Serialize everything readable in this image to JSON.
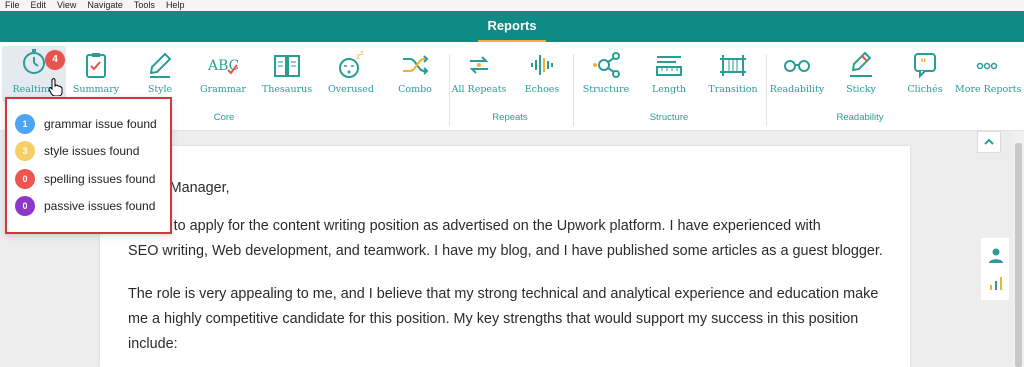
{
  "menu": [
    "File",
    "Edit",
    "View",
    "Navigate",
    "Tools",
    "Help"
  ],
  "header": {
    "title": "Reports"
  },
  "badge_count": "4",
  "tools": [
    {
      "label": "Realtime",
      "icon": "stopwatch-icon"
    },
    {
      "label": "Summary",
      "icon": "clipboard-icon"
    },
    {
      "label": "Style",
      "icon": "pen-icon"
    },
    {
      "label": "Grammar",
      "icon": "abc-check-icon"
    },
    {
      "label": "Thesaurus",
      "icon": "book-icon"
    },
    {
      "label": "Overused",
      "icon": "sleepy-face-icon"
    },
    {
      "label": "Combo",
      "icon": "shuffle-icon"
    },
    {
      "label": "All Repeats",
      "icon": "repeat-arrows-icon"
    },
    {
      "label": "Echoes",
      "icon": "sound-wave-icon"
    },
    {
      "label": "Structure",
      "icon": "network-icon"
    },
    {
      "label": "Length",
      "icon": "ruler-icon"
    },
    {
      "label": "Transition",
      "icon": "bridge-icon"
    },
    {
      "label": "Readability",
      "icon": "glasses-icon"
    },
    {
      "label": "Sticky",
      "icon": "sticky-pencil-icon"
    },
    {
      "label": "Clichés",
      "icon": "quote-bubble-icon"
    },
    {
      "label": "More Reports",
      "icon": "more-dots-icon"
    }
  ],
  "groups": [
    "Core",
    "Repeats",
    "Structure",
    "Readability"
  ],
  "popup": [
    {
      "count": "1",
      "text": "grammar issue found",
      "color": "#4da3f5"
    },
    {
      "count": "3",
      "text": "style issues found",
      "color": "#f5cf63"
    },
    {
      "count": "0",
      "text": "spelling issues found",
      "color": "#ee5550"
    },
    {
      "count": "0",
      "text": "passive issues found",
      "color": "#8e36c9"
    }
  ],
  "document": {
    "line1": "Hiring Manager,",
    "para1a": "writing to apply for the content writing position as advertised on the Upwork platform. I have experienced with",
    "para1b": "SEO writing, Web development, and teamwork. I have my blog, and I have published some articles as a guest blogger.",
    "para2a": "The role is very appealing to me, and I believe that my strong technical and analytical experience and education make",
    "para2b": "me a highly competitive candidate for this position. My key strengths that would support my success in this position",
    "para2c": "include:"
  },
  "colors": {
    "header": "#0f8a84",
    "accent": "#2a9d95",
    "popup_border": "#d3353a",
    "badge": "#e8534d"
  }
}
